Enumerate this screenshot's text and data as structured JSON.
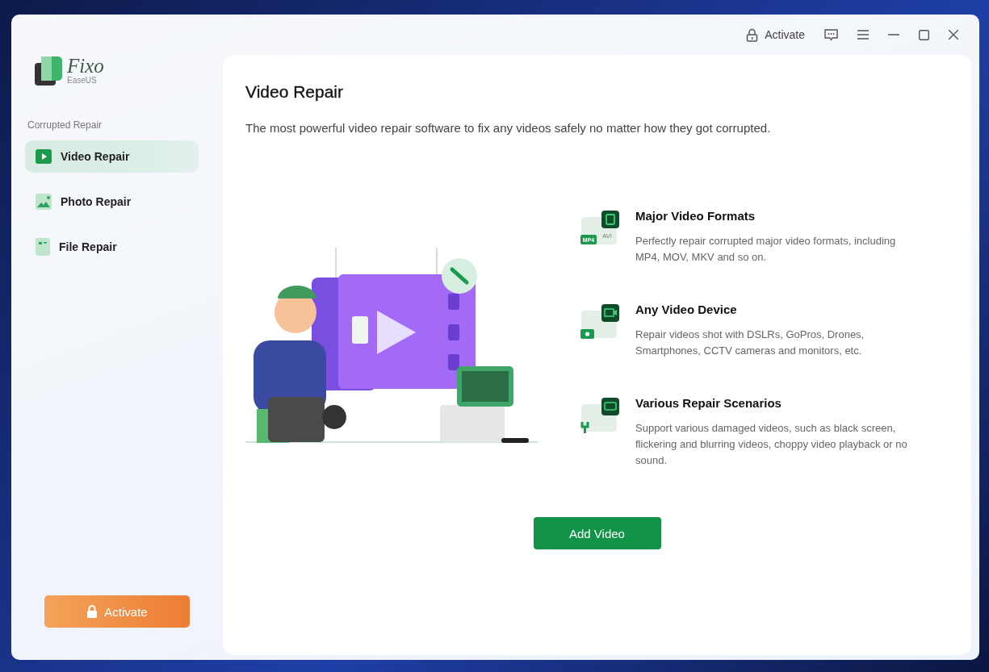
{
  "logo": {
    "name": "Fixo",
    "brand": "EaseUS"
  },
  "titlebar": {
    "activate": "Activate"
  },
  "sidebar": {
    "section": "Corrupted Repair",
    "items": [
      {
        "label": "Video Repair",
        "kind": "video",
        "selected": true
      },
      {
        "label": "Photo Repair",
        "kind": "photo",
        "selected": false
      },
      {
        "label": "File Repair",
        "kind": "file",
        "selected": false
      }
    ],
    "activate_button": "Activate"
  },
  "main": {
    "title": "Video Repair",
    "subtitle": "The most powerful video repair software to fix any videos safely no matter how they got corrupted.",
    "features": [
      {
        "kind": "formats",
        "title": "Major Video Formats",
        "text": "Perfectly repair corrupted major video formats, including MP4, MOV, MKV and so on.",
        "badge": "MP4",
        "tag": "AVI"
      },
      {
        "kind": "device",
        "title": "Any Video Device",
        "text": "Repair videos shot with DSLRs, GoPros, Drones, Smartphones, CCTV cameras and monitors, etc."
      },
      {
        "kind": "scenarios",
        "title": "Various Repair Scenarios",
        "text": "Support various damaged videos, such as black screen, flickering and blurring videos, choppy video playback or no sound."
      }
    ],
    "button": "Add Video"
  }
}
